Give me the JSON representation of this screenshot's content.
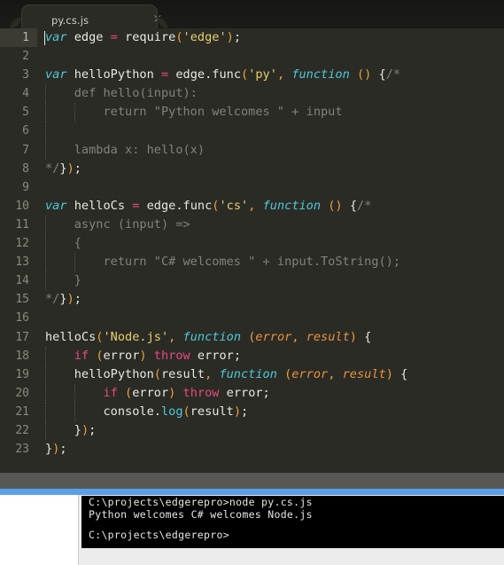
{
  "window": {
    "title": "py.cs.js",
    "accent_blue": "#5aa0e8",
    "splitter_gray": "#575753",
    "editor_bg": "#2b2b26",
    "tabbar_bg": "#1b1b17"
  },
  "tab": {
    "label": "py.cs.js",
    "close_glyph": "×"
  },
  "editor": {
    "language": "JavaScript",
    "active_line": 1,
    "line_numbers": [
      "1",
      "2",
      "3",
      "4",
      "5",
      "6",
      "7",
      "8",
      "9",
      "10",
      "11",
      "12",
      "13",
      "14",
      "15",
      "16",
      "17",
      "18",
      "19",
      "20",
      "21",
      "22",
      "23"
    ],
    "lines": [
      {
        "n": "1",
        "text": "var edge = require('edge');"
      },
      {
        "n": "2",
        "text": ""
      },
      {
        "n": "3",
        "text": "var helloPython = edge.func('py', function () {/*"
      },
      {
        "n": "4",
        "text": "    def hello(input):"
      },
      {
        "n": "5",
        "text": "        return \"Python welcomes \" + input"
      },
      {
        "n": "6",
        "text": ""
      },
      {
        "n": "7",
        "text": "    lambda x: hello(x)"
      },
      {
        "n": "8",
        "text": "*/});"
      },
      {
        "n": "9",
        "text": ""
      },
      {
        "n": "10",
        "text": "var helloCs = edge.func('cs', function () {/*"
      },
      {
        "n": "11",
        "text": "    async (input) =>"
      },
      {
        "n": "12",
        "text": "    {"
      },
      {
        "n": "13",
        "text": "        return \"C# welcomes \" + input.ToString();"
      },
      {
        "n": "14",
        "text": "    }"
      },
      {
        "n": "15",
        "text": "*/});"
      },
      {
        "n": "16",
        "text": ""
      },
      {
        "n": "17",
        "text": "helloCs('Node.js', function (error, result) {"
      },
      {
        "n": "18",
        "text": "    if (error) throw error;"
      },
      {
        "n": "19",
        "text": "    helloPython(result, function (error, result) {"
      },
      {
        "n": "20",
        "text": "        if (error) throw error;"
      },
      {
        "n": "21",
        "text": "        console.log(result);"
      },
      {
        "n": "22",
        "text": "    });"
      },
      {
        "n": "23",
        "text": "});"
      }
    ]
  },
  "console": {
    "lines": [
      "C:\\projects\\edgerepro>node py.cs.js",
      "Python welcomes C# welcomes Node.js",
      "",
      "C:\\projects\\edgerepro>"
    ],
    "prompt": "C:\\projects\\edgerepro>",
    "command": "node py.cs.js",
    "output": "Python welcomes C# welcomes Node.js"
  }
}
